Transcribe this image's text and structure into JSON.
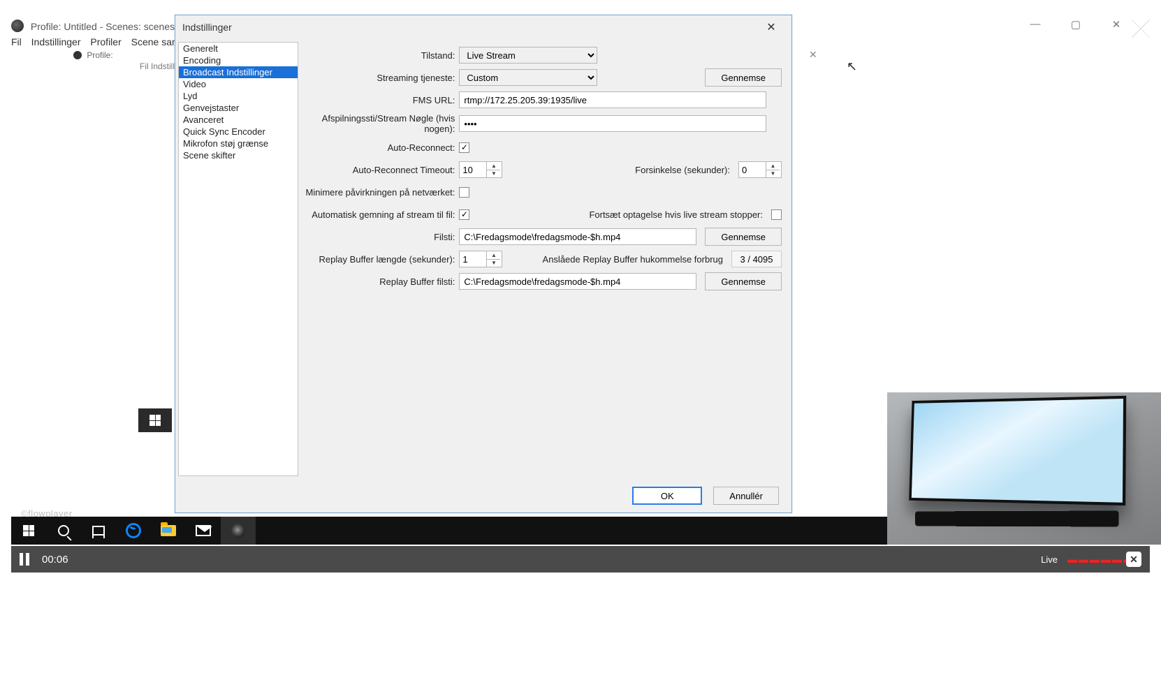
{
  "bg": {
    "title": "Profile: Untitled - Scenes: scenes - Op",
    "menus": [
      "Fil",
      "Indstillinger",
      "Profiler",
      "Scene samling"
    ],
    "nested_title": "Profile:",
    "nested_menus": "Fil   Indstill"
  },
  "dialog": {
    "title": "Indstillinger",
    "sidebar": [
      "Generelt",
      "Encoding",
      "Broadcast Indstillinger",
      "Video",
      "Lyd",
      "Genvejstaster",
      "Avanceret",
      "Quick Sync Encoder",
      "Mikrofon støj grænse",
      "Scene skifter"
    ],
    "selected_index": 2,
    "labels": {
      "mode": "Tilstand:",
      "service": "Streaming tjeneste:",
      "fms": "FMS URL:",
      "key": "Afspilningssti/Stream Nøgle (hvis nogen):",
      "auto_reconnect": "Auto-Reconnect:",
      "auto_timeout": "Auto-Reconnect Timeout:",
      "delay": "Forsinkelse (sekunder):",
      "min_net": "Minimere påvirkningen på netværket:",
      "auto_save": "Automatisk gemning af stream til fil:",
      "keep_rec": "Fortsæt optagelse hvis live stream stopper:",
      "path": "Filsti:",
      "buf_len": "Replay Buffer længde (sekunder):",
      "buf_mem": "Anslåede Replay Buffer hukommelse forbrug",
      "buf_path": "Replay Buffer filsti:"
    },
    "values": {
      "mode": "Live Stream",
      "service": "Custom",
      "fms": "rtmp://172.25.205.39:1935/live",
      "key": "••••",
      "auto_reconnect": true,
      "auto_timeout": "10",
      "delay": "0",
      "min_net": false,
      "auto_save": true,
      "keep_rec": false,
      "path": "C:\\Fredagsmode\\fredagsmode-$h.mp4",
      "buf_len": "1",
      "buf_mem": "3 / 4095",
      "buf_path": "C:\\Fredagsmode\\fredagsmode-$h.mp4"
    },
    "buttons": {
      "browse": "Gennemse",
      "ok": "OK",
      "cancel": "Annullér"
    }
  },
  "player": {
    "time": "00:06",
    "live": "Live"
  },
  "footer": {
    "brand": "©flowplayer"
  }
}
